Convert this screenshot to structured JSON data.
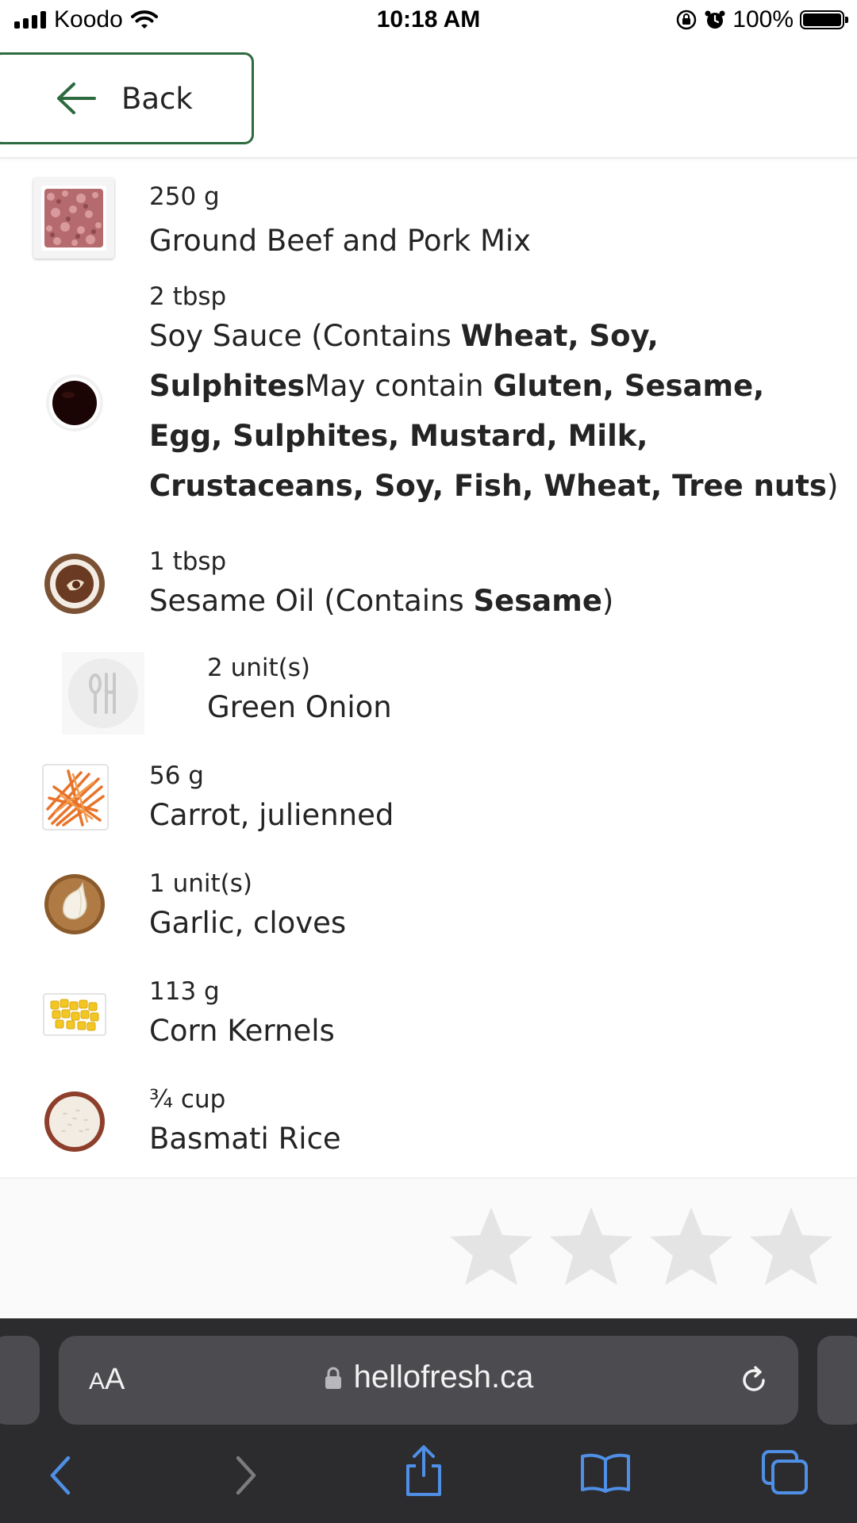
{
  "status_bar": {
    "carrier": "Koodo",
    "time": "10:18 AM",
    "battery": "100%"
  },
  "header": {
    "back_label": "Back"
  },
  "ingredients": [
    {
      "qty": "250 g",
      "name_parts": [
        {
          "t": "Ground Beef and Pork Mix",
          "b": false
        }
      ],
      "thumb": "ground-meat"
    },
    {
      "qty": "2 tbsp",
      "name_parts": [
        {
          "t": "Soy Sauce (Contains ",
          "b": false
        },
        {
          "t": "Wheat, Soy, Sulphites",
          "b": true
        },
        {
          "t": "May contain ",
          "b": false
        },
        {
          "t": "Gluten, Sesame, Egg, Sulphites, Mustard, Milk, Crustaceans, Soy, Fish, Wheat, Tree nuts",
          "b": true
        },
        {
          "t": ")",
          "b": false
        }
      ],
      "thumb": "soy-sauce"
    },
    {
      "qty": "1 tbsp",
      "name_parts": [
        {
          "t": "Sesame Oil (Contains ",
          "b": false
        },
        {
          "t": "Sesame",
          "b": true
        },
        {
          "t": ")",
          "b": false
        }
      ],
      "thumb": "sesame-oil"
    },
    {
      "qty": "2 unit(s)",
      "name_parts": [
        {
          "t": "Green Onion",
          "b": false
        }
      ],
      "thumb": "placeholder-utensils"
    },
    {
      "qty": "56 g",
      "name_parts": [
        {
          "t": "Carrot, julienned",
          "b": false
        }
      ],
      "thumb": "carrot"
    },
    {
      "qty": "1 unit(s)",
      "name_parts": [
        {
          "t": "Garlic, cloves",
          "b": false
        }
      ],
      "thumb": "garlic"
    },
    {
      "qty": "113 g",
      "name_parts": [
        {
          "t": "Corn Kernels",
          "b": false
        }
      ],
      "thumb": "corn"
    },
    {
      "qty": "¾ cup",
      "name_parts": [
        {
          "t": "Basmati Rice",
          "b": false
        }
      ],
      "thumb": "rice"
    }
  ],
  "rating": {
    "max_stars": 4,
    "value": 0,
    "colors": {
      "empty": "#e4e4e4"
    }
  },
  "browser": {
    "aa_small": "A",
    "aa_big": "A",
    "url": "hellofresh.ca"
  },
  "colors": {
    "brand_green": "#2d6a3f",
    "browser_bg": "#2c2c2e",
    "toolbar_blue": "#4f8fe6"
  }
}
